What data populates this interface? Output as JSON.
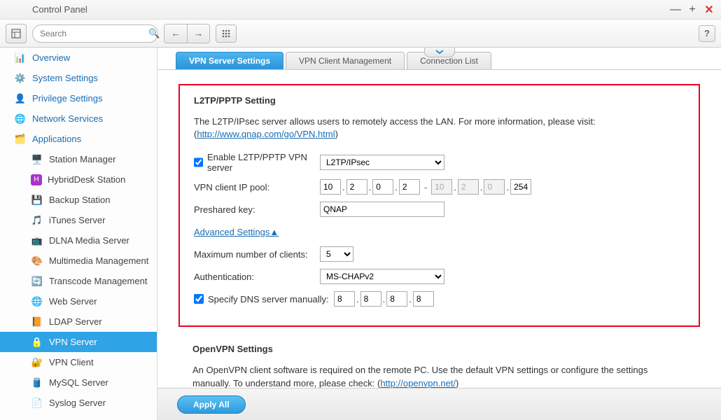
{
  "window": {
    "title": "Control Panel"
  },
  "toolbar": {
    "search_placeholder": "Search"
  },
  "sidebar": {
    "items": [
      {
        "label": "Overview",
        "type": "top"
      },
      {
        "label": "System Settings",
        "type": "top"
      },
      {
        "label": "Privilege Settings",
        "type": "top"
      },
      {
        "label": "Network Services",
        "type": "top"
      },
      {
        "label": "Applications",
        "type": "top"
      },
      {
        "label": "Station Manager",
        "type": "sub"
      },
      {
        "label": "HybridDesk Station",
        "type": "sub"
      },
      {
        "label": "Backup Station",
        "type": "sub"
      },
      {
        "label": "iTunes Server",
        "type": "sub"
      },
      {
        "label": "DLNA Media Server",
        "type": "sub"
      },
      {
        "label": "Multimedia Management",
        "type": "sub"
      },
      {
        "label": "Transcode Management",
        "type": "sub"
      },
      {
        "label": "Web Server",
        "type": "sub"
      },
      {
        "label": "LDAP Server",
        "type": "sub"
      },
      {
        "label": "VPN Server",
        "type": "sub",
        "selected": true
      },
      {
        "label": "VPN Client",
        "type": "sub"
      },
      {
        "label": "MySQL Server",
        "type": "sub"
      },
      {
        "label": "Syslog Server",
        "type": "sub"
      }
    ]
  },
  "tabs": [
    {
      "label": "VPN Server Settings",
      "active": true
    },
    {
      "label": "VPN Client Management"
    },
    {
      "label": "Connection List"
    }
  ],
  "l2tp": {
    "title": "L2TP/PPTP Setting",
    "desc1": "The L2TP/IPsec server allows users to remotely access the LAN. For more information, please visit: (",
    "link": "http://www.qnap.com/go/VPN.html",
    "desc2": ")",
    "enable_label": "Enable L2TP/PPTP VPN server",
    "protocol": "L2TP/IPsec",
    "ip_pool_label": "VPN client IP pool:",
    "ip_start": [
      "10",
      "2",
      "0",
      "2"
    ],
    "ip_end": [
      "10",
      "2",
      "0",
      "254"
    ],
    "psk_label": "Preshared key:",
    "psk_value": "QNAP",
    "advanced": "Advanced Settings▲",
    "max_label": "Maximum number of clients:",
    "max_value": "5",
    "auth_label": "Authentication:",
    "auth_value": "MS-CHAPv2",
    "dns_label": "Specify DNS server manually:",
    "dns_ip": [
      "8",
      "8",
      "8",
      "8"
    ]
  },
  "openvpn": {
    "title": "OpenVPN Settings",
    "desc1": "An OpenVPN client software is required on the remote PC. Use the default VPN settings or configure the settings manually. To understand more, please check: (",
    "link": "http://openvpn.net/",
    "desc2": ")"
  },
  "footer": {
    "apply": "Apply All"
  }
}
